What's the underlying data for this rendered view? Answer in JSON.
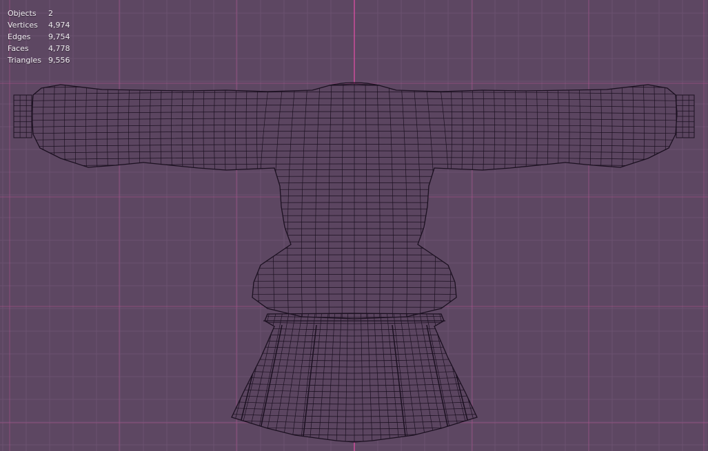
{
  "viewport": {
    "background_color": "#5d4762",
    "grid_minor_color": "#6a5270",
    "grid_major_color": "#b0508e",
    "axis_color": "#e84fa8",
    "wire_color": "#1b1020",
    "fill_color": "#5b4560"
  },
  "stats": [
    {
      "label": "Objects",
      "value": "2"
    },
    {
      "label": "Vertices",
      "value": "4,974"
    },
    {
      "label": "Edges",
      "value": "9,754"
    },
    {
      "label": "Faces",
      "value": "4,778"
    },
    {
      "label": "Triangles",
      "value": "9,556"
    }
  ]
}
